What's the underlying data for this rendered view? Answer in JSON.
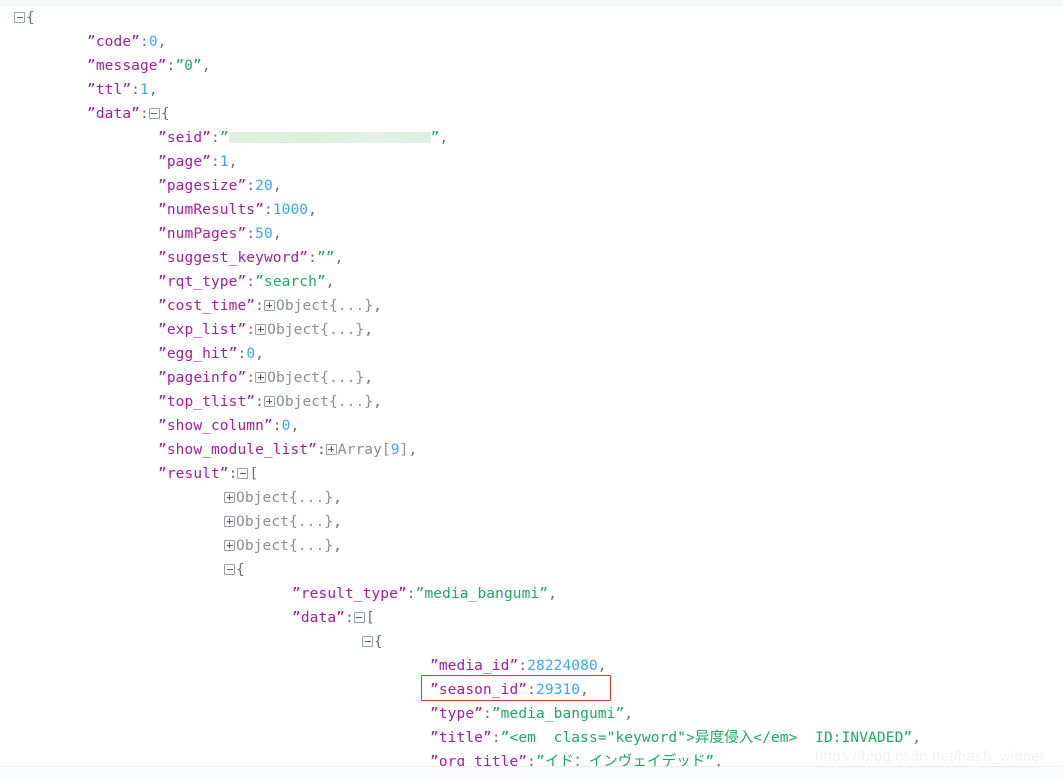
{
  "viewer": {
    "type": "json-tree-viewer",
    "watermark": "https://blog.csdn.net/bash_winner",
    "colors": {
      "key": "#a61ba0",
      "string": "#1aab5c",
      "number": "#3aa8e8",
      "punctuation": "#6c6c78",
      "placeholder": "#8c8c96",
      "highlight_border": "#e8352a",
      "redaction": "#e2f0e4",
      "background": "#ffffff"
    },
    "highlight": {
      "target_line": "season_id",
      "border_color": "#e8352a"
    }
  },
  "lines": [
    {
      "indent": 0,
      "toggle": "minus",
      "open": "{"
    },
    {
      "indent": 1,
      "key": "code",
      "num": "0",
      "tail": ","
    },
    {
      "indent": 1,
      "key": "message",
      "str": "0",
      "tail": ","
    },
    {
      "indent": 1,
      "key": "ttl",
      "num": "1",
      "tail": ","
    },
    {
      "indent": 1,
      "key": "data",
      "toggle": "minus",
      "open": "{"
    },
    {
      "indent": 2,
      "key": "seid",
      "redacted": true,
      "tail": ","
    },
    {
      "indent": 2,
      "key": "page",
      "num": "1",
      "tail": ","
    },
    {
      "indent": 2,
      "key": "pagesize",
      "num": "20",
      "tail": ","
    },
    {
      "indent": 2,
      "key": "numResults",
      "num": "1000",
      "tail": ","
    },
    {
      "indent": 2,
      "key": "numPages",
      "num": "50",
      "tail": ","
    },
    {
      "indent": 2,
      "key": "suggest_keyword",
      "str": "",
      "tail": ","
    },
    {
      "indent": 2,
      "key": "rqt_type",
      "str": "search",
      "tail": ","
    },
    {
      "indent": 2,
      "key": "cost_time",
      "toggle": "plus",
      "collapsed": "Object{...}",
      "tail": ","
    },
    {
      "indent": 2,
      "key": "exp_list",
      "toggle": "plus",
      "collapsed": "Object{...}",
      "tail": ","
    },
    {
      "indent": 2,
      "key": "egg_hit",
      "num": "0",
      "tail": ","
    },
    {
      "indent": 2,
      "key": "pageinfo",
      "toggle": "plus",
      "collapsed": "Object{...}",
      "tail": ","
    },
    {
      "indent": 2,
      "key": "top_tlist",
      "toggle": "plus",
      "collapsed": "Object{...}",
      "tail": ","
    },
    {
      "indent": 2,
      "key": "show_column",
      "num": "0",
      "tail": ","
    },
    {
      "indent": 2,
      "key": "show_module_list",
      "toggle": "plus",
      "collapsed_pre": "Array[",
      "collapsed_num": "9",
      "collapsed_post": "]",
      "tail": ","
    },
    {
      "indent": 2,
      "key": "result",
      "toggle": "minus",
      "open": "["
    },
    {
      "indent": 3,
      "toggle": "plus",
      "collapsed": "Object{...}",
      "tail": ","
    },
    {
      "indent": 3,
      "toggle": "plus",
      "collapsed": "Object{...}",
      "tail": ","
    },
    {
      "indent": 3,
      "toggle": "plus",
      "collapsed": "Object{...}",
      "tail": ","
    },
    {
      "indent": 3,
      "toggle": "minus",
      "open": "{"
    },
    {
      "indent": 4,
      "key": "result_type",
      "str": "media_bangumi",
      "tail": ","
    },
    {
      "indent": 4,
      "key": "data",
      "toggle": "minus",
      "open": "["
    },
    {
      "indent": 5,
      "toggle": "minus",
      "open": "{"
    },
    {
      "indent": 6,
      "key": "media_id",
      "num": "28224080",
      "tail": ","
    },
    {
      "indent": 6,
      "key": "season_id",
      "num": "29310",
      "tail": ",",
      "highlighted": true
    },
    {
      "indent": 6,
      "key": "type",
      "str": "media_bangumi",
      "tail": ","
    },
    {
      "indent": 6,
      "key": "title",
      "str": "<em  class=\"keyword\">异度侵入</em>  ID:INVADED",
      "tail": ","
    },
    {
      "indent": 6,
      "key": "org_title",
      "str": "イド：インヴェイデッド",
      "tail": ","
    }
  ]
}
